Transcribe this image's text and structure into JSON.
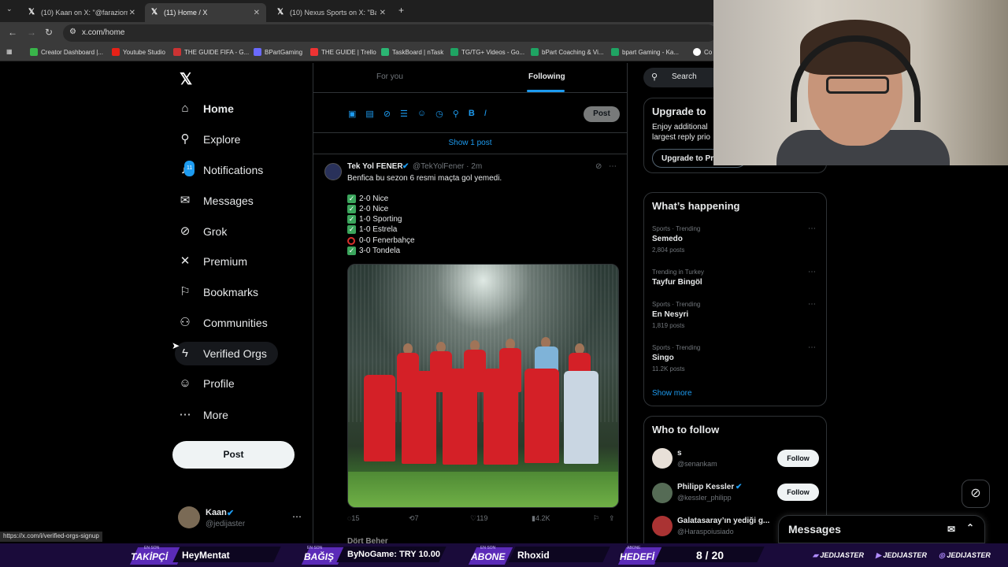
{
  "browser": {
    "tabs": [
      {
        "title": "(10) Kaan on X: \"@faraziornek I"
      },
      {
        "title": "(11) Home / X"
      },
      {
        "title": "(10) Nexus Sports on X: \"Barış A"
      }
    ],
    "url": "x.com/home",
    "bookmarks": [
      "Creator Dashboard |...",
      "Youtube Studio",
      "THE GUIDE FIFA - G...",
      "BPartGaming",
      "THE GUIDE | Trello",
      "TaskBoard | nTask",
      "TG/TG+ Videos - Go...",
      "bPart Coaching & Vi...",
      "bpart Gaming - Ka...",
      "Co"
    ],
    "status_url": "https://x.com/i/verified-orgs-signup"
  },
  "nav": {
    "brand": "X",
    "items": [
      {
        "label": "Home",
        "icon": "home-icon",
        "glyph": "⌂"
      },
      {
        "label": "Explore",
        "icon": "search-icon",
        "glyph": "⚲"
      },
      {
        "label": "Notifications",
        "icon": "bell-icon",
        "glyph": "🔔"
      },
      {
        "label": "Messages",
        "icon": "envelope-icon",
        "glyph": "✉"
      },
      {
        "label": "Grok",
        "icon": "grok-icon",
        "glyph": "⊘"
      },
      {
        "label": "Premium",
        "icon": "x-icon",
        "glyph": "✕"
      },
      {
        "label": "Bookmarks",
        "icon": "bookmark-icon",
        "glyph": "⚑"
      },
      {
        "label": "Communities",
        "icon": "people-icon",
        "glyph": "👥"
      },
      {
        "label": "Verified Orgs",
        "icon": "lightning-icon",
        "glyph": "ϟ"
      },
      {
        "label": "Profile",
        "icon": "person-icon",
        "glyph": "☺"
      },
      {
        "label": "More",
        "icon": "more-icon",
        "glyph": "⋯"
      }
    ],
    "notification_badge": "11",
    "post_button": "Post",
    "account": {
      "name": "Kaan",
      "handle": "@jedijaster"
    }
  },
  "timeline": {
    "tabs": [
      "For you",
      "Following"
    ],
    "composer_post_button": "Post",
    "show_posts": "Show 1 post",
    "tweet": {
      "name": "Tek Yol FENER",
      "handle": "@TekYolFener · 2m",
      "text": "Benfica bu sezon 6 resmi maçta gol yemedi.",
      "lines": [
        {
          "mark": "check",
          "text": "2-0 Nice"
        },
        {
          "mark": "check",
          "text": "2-0 Nice"
        },
        {
          "mark": "check",
          "text": "1-0 Sporting"
        },
        {
          "mark": "check",
          "text": "1-0 Estrela"
        },
        {
          "mark": "circle",
          "text": "0-0 Fenerbahçe"
        },
        {
          "mark": "check",
          "text": "3-0 Tondela"
        }
      ],
      "replies": "15",
      "reposts": "7",
      "likes": "119",
      "views": "4.2K"
    },
    "next_tweet_name": "Dört Beher"
  },
  "sidebar": {
    "search_placeholder": "Search",
    "premium": {
      "title": "Upgrade to",
      "text1": "Enjoy additional",
      "text2": "largest reply prio",
      "button": "Upgrade to Pr"
    },
    "trends_title": "What’s happening",
    "trends": [
      {
        "category": "Sports · Trending",
        "name": "Semedo",
        "count": "2,804 posts"
      },
      {
        "category": "Trending in Turkey",
        "name": "Tayfur Bingöl",
        "count": ""
      },
      {
        "category": "Sports · Trending",
        "name": "En Nesyri",
        "count": "1,819 posts"
      },
      {
        "category": "Sports · Trending",
        "name": "Singo",
        "count": "11.2K posts"
      }
    ],
    "show_more": "Show more",
    "wtf_title": "Who to follow",
    "wtf": [
      {
        "name": "s",
        "handle": "@senankam",
        "button": "Follow"
      },
      {
        "name": "Philipp Kessler",
        "handle": "@kessler_philipp",
        "button": "Follow"
      },
      {
        "name": "Galatasaray’ın yediği g...",
        "handle": "@Haraspoiusiado",
        "button": ""
      }
    ],
    "messages": "Messages"
  },
  "stream": {
    "follower_small": "EN SON",
    "follower_label": "TAKİPÇİ",
    "follower_value": "HeyMentat",
    "donation_small": "EN SON",
    "donation_label": "BAĞIŞ",
    "donation_value": "ByNoGame: TRY 10.00",
    "sub_small": "EN SON",
    "sub_label": "ABONE",
    "sub_value": "Rhoxid",
    "goal_small": "ABONE",
    "goal_label": "HEDEFİ",
    "goal_value": "8 / 20",
    "socials": [
      "JEDIJASTER",
      "JEDIJASTER",
      "JEDIJASTER"
    ]
  },
  "colors": {
    "accent": "#1d9bf0",
    "stream_purple": "#5b2bb8"
  }
}
